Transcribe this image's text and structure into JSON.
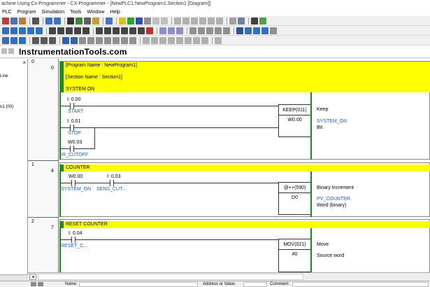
{
  "window": {
    "title": "achine Using Cx-Programmer - CX-Programmer - [NewPLC1.NewProgram1.Section1 [Diagram]]",
    "menu": [
      "PLC",
      "Program",
      "Simulation",
      "Tools",
      "Window",
      "Help"
    ]
  },
  "brand": "InstrumentationTools.com",
  "left_panel": {
    "close": "×",
    "line1": "Line",
    "line2": "n1 (00)"
  },
  "diagram": {
    "program_name": "[Program Name : NewProgram1]",
    "section_name": "[Section Name : Section1]",
    "rungs": [
      {
        "number": "0",
        "step": "0",
        "title": "SYSTEM ON",
        "contacts": [
          {
            "address": "I: 0.00",
            "symbol": "START"
          },
          {
            "address": "I: 0.01",
            "symbol": "STOP"
          },
          {
            "address": "W0.03",
            "symbol": "IR_CUTOFF"
          }
        ],
        "instruction": {
          "name": "KEEP(011)",
          "operand": "W0.00"
        },
        "comment": {
          "title": "Keep",
          "operand_symbol": "SYSTEM_ON",
          "operand_type": "Bit"
        }
      },
      {
        "number": "1",
        "step": "4",
        "title": "COUNTER",
        "contacts": [
          {
            "address": "W0.00",
            "symbol": "SYSTEM_ON"
          },
          {
            "address": "I: 0.03",
            "symbol": "SENS_CUT..."
          }
        ],
        "instruction": {
          "name": "@++(590)",
          "operand": "D0"
        },
        "comment": {
          "title": "Binary Increment",
          "operand_symbol": "PV_COUNTER",
          "operand_type": "Word (binary)"
        }
      },
      {
        "number": "2",
        "step": "7",
        "title": "RESET COUNTER",
        "contacts": [
          {
            "address": "I: 0.04",
            "symbol": "RESET_C..."
          }
        ],
        "instruction": {
          "name": "MOV(021)",
          "operand": "#0"
        },
        "comment": {
          "title": "Move",
          "operand_label": "Source word"
        }
      }
    ]
  },
  "scrollbar": {
    "left_arrow": "◂"
  },
  "status": {
    "name_label": "Name:",
    "address_label": "Address or Value:",
    "comment_label": "Comment:"
  },
  "colors": {
    "rung_bar": "#ffff00",
    "rail": "#1e8a1e",
    "symbol": "#1a5fd0"
  }
}
